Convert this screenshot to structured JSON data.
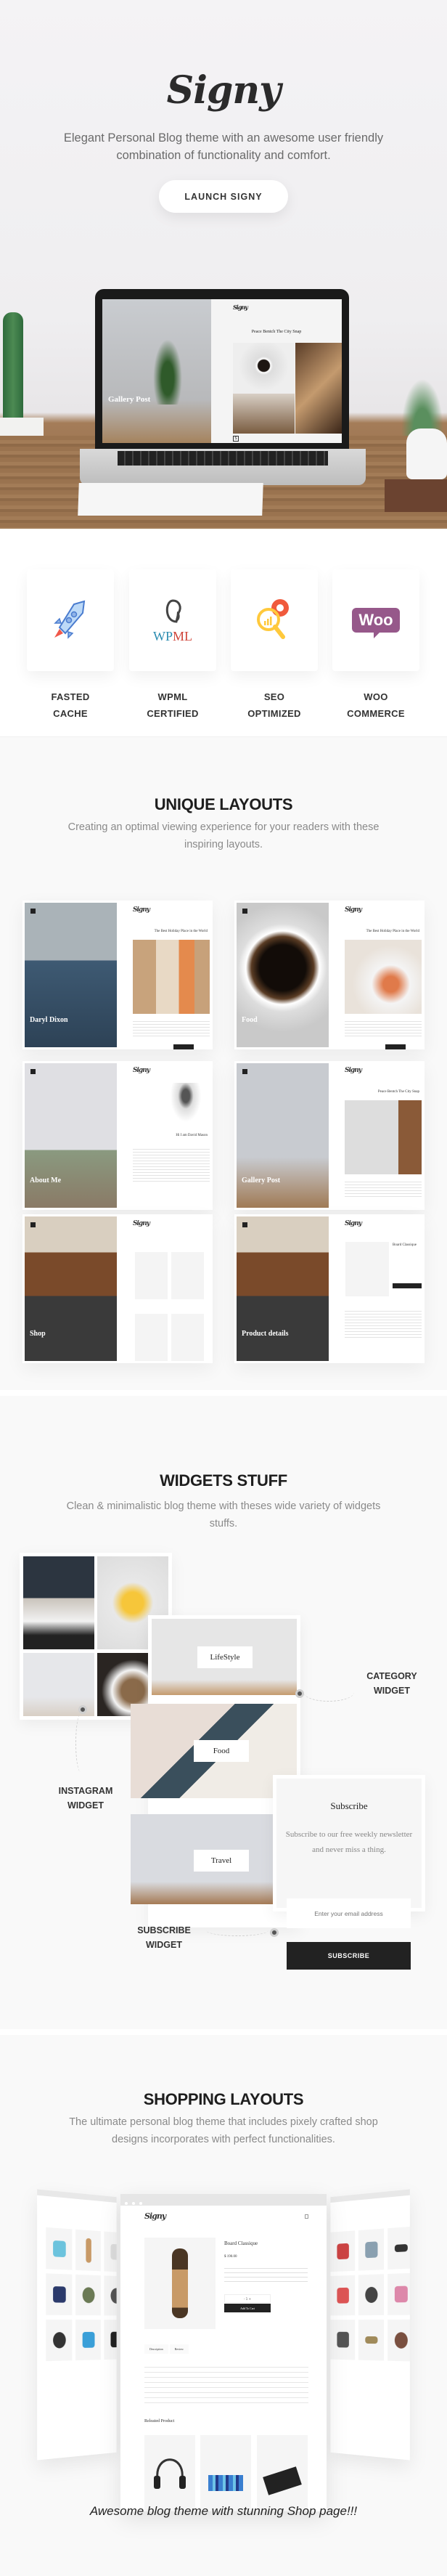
{
  "hero": {
    "logo": "Signy",
    "tagline": "Elegant Personal Blog theme with an awesome user friendly combination of functionality and comfort.",
    "launch_label": "LAUNCH SIGNY",
    "laptop_screen": {
      "left_title": "Gallery Post",
      "right_logo": "Signy",
      "right_post_title": "Peace Bentch The City Snap",
      "dropcap": "S"
    }
  },
  "features": [
    {
      "icon": "rocket-icon",
      "label": "FASTED\nCACHE"
    },
    {
      "icon": "wpml-logo-icon",
      "icon_text": "WPML",
      "label": "WPML\nCERTIFIED"
    },
    {
      "icon": "seo-magnifier-gear-icon",
      "label": "SEO\nOPTIMIZED"
    },
    {
      "icon": "woo-logo-icon",
      "icon_text": "Woo",
      "label": "WOO\nCOMMERCE"
    }
  ],
  "layouts": {
    "title": "UNIQUE LAYOUTS",
    "subtitle": "Creating an optimal viewing experience for your readers with these inspiring layouts.",
    "items": [
      {
        "caption": "Daryl Dixon",
        "logo": "Signy",
        "post_title": "The Best Holiday Place in the World"
      },
      {
        "caption": "Food",
        "logo": "Signy",
        "post_title": "The Best Holiday Place in the World"
      },
      {
        "caption": "About Me",
        "logo": "Signy",
        "post_title": "Hi I am David Mason"
      },
      {
        "caption": "Gallery Post",
        "logo": "Signy",
        "post_title": "Peace Bentch The City Snap"
      },
      {
        "caption": "Shop",
        "logo": "Signy",
        "post_title": ""
      },
      {
        "caption": "Product details",
        "logo": "Signy",
        "post_title": "Board Classique"
      }
    ]
  },
  "widgets": {
    "title": "WIDGETS STUFF",
    "subtitle": "Clean & minimalistic blog theme with theses wide variety of widgets stuffs.",
    "categories": [
      "LifeStyle",
      "Food",
      "Travel"
    ],
    "labels": {
      "instagram": "INSTAGRAM\nWIDGET",
      "category": "CATEGORY\nWIDGET",
      "subscribe": "SUBSCRIBE\nWIDGET"
    },
    "subscribe": {
      "title": "Subscribe",
      "description": "Subscribe to our free weekly newsletter and never miss a thing.",
      "email_placeholder": "Enter your email address",
      "button_label": "SUBSCRIBE"
    }
  },
  "shopping": {
    "title": "SHOPPING LAYOUTS",
    "subtitle": "The ultimate personal blog theme that includes pixely crafted shop designs incorporates with perfect functionalities.",
    "product": {
      "logo": "Signy",
      "name": "Board Classique",
      "price": "$ 190.00",
      "qty": "- 1 +",
      "add_to_cart": "Add To Cart",
      "tabs": [
        "Description",
        "Review"
      ],
      "related_title": "Releated Product"
    },
    "cta": "Awesome blog theme with stunning Shop page!!!"
  }
}
